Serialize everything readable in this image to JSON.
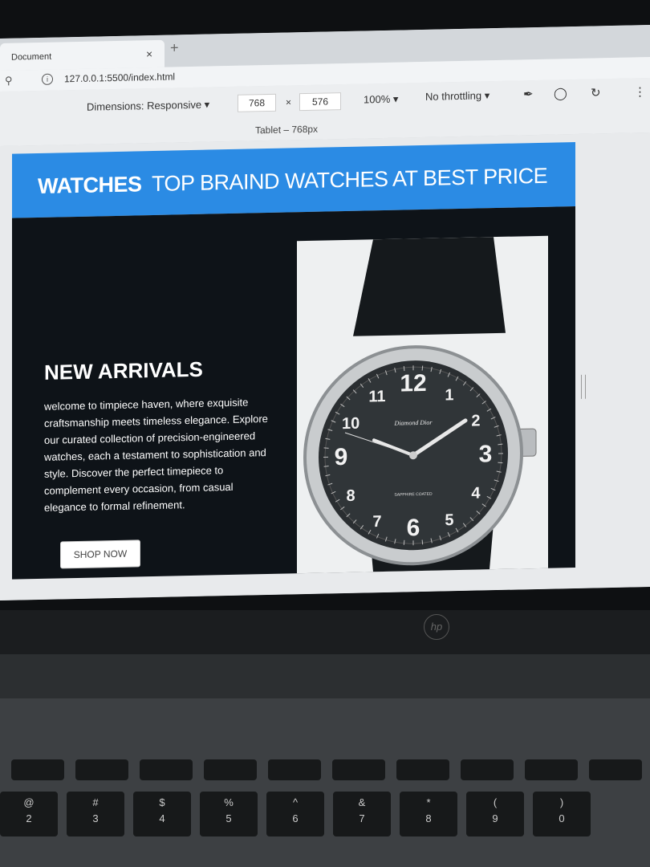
{
  "browser": {
    "tab_title": "Document",
    "tab_close": "×",
    "new_tab": "+",
    "url": "127.0.0.1:5500/index.html"
  },
  "devtools": {
    "dimensions_label": "Dimensions: Responsive ▾",
    "width": "768",
    "times": "×",
    "height": "576",
    "zoom": "100% ▾",
    "throttling": "No throttling ▾",
    "preset_label": "Tablet – 768px"
  },
  "site": {
    "header_bold": "WATCHES",
    "header_rest": "TOP BRAIND WATCHES AT BEST PRICE",
    "hero_title": "NEW ARRIVALS",
    "hero_text": "welcome to timpiece haven, where exquisite craftsmanship meets timeless elegance. Explore our curated collection of precision-engineered watches, each a testament to sophistication and style. Discover the perfect timepiece to complement every occasion, from casual elegance to formal refinement.",
    "button_label": "SHOP NOW",
    "watch_brand": "Diamond Dior",
    "watch_subtext": "SAPPHIRE COATED",
    "dial_numbers": [
      "12",
      "1",
      "2",
      "3",
      "4",
      "5",
      "6",
      "7",
      "8",
      "9",
      "10",
      "11"
    ]
  },
  "laptop": {
    "brand": "hp",
    "number_keys": [
      "2",
      "3",
      "4",
      "5",
      "6",
      "7",
      "8",
      "9",
      "0"
    ],
    "number_symbols": [
      "@",
      "#",
      "$",
      "%",
      "^",
      "&",
      "*",
      "(",
      ")"
    ]
  }
}
